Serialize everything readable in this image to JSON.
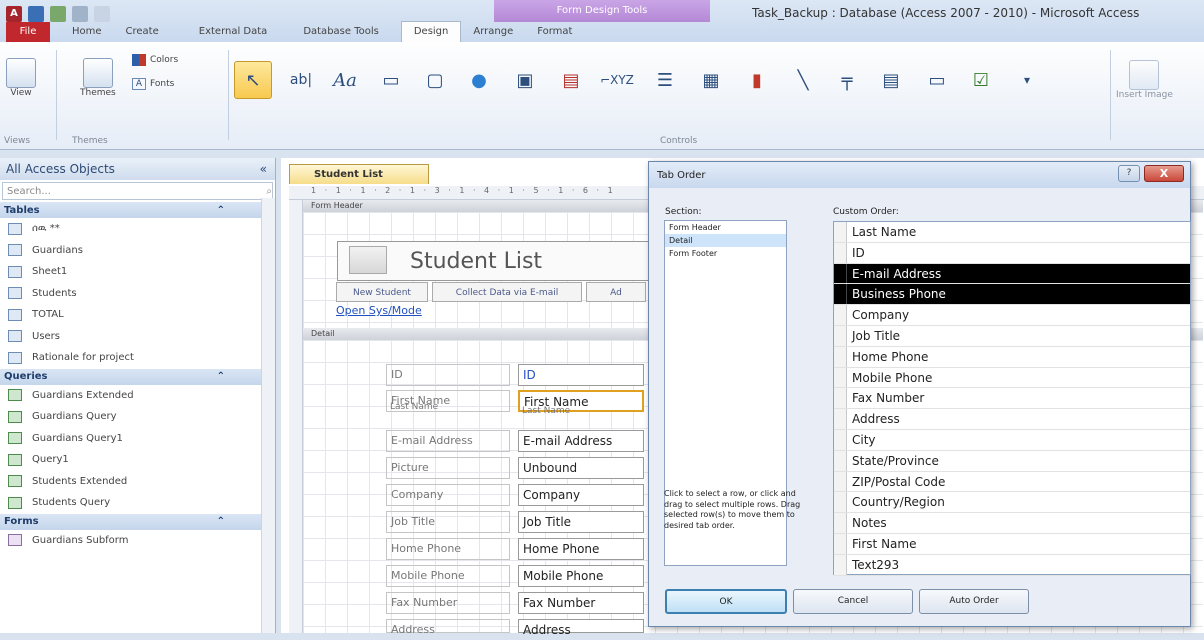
{
  "window": {
    "title": "Task_Backup : Database (Access 2007 - 2010)  -  Microsoft Access"
  },
  "app_icon_label": "A",
  "context_tab": {
    "label": "Form Design Tools"
  },
  "ribbon_tabs": [
    {
      "label": "File"
    },
    {
      "label": "Home"
    },
    {
      "label": "Create"
    },
    {
      "label": "External Data"
    },
    {
      "label": "Database Tools"
    },
    {
      "label": "Design"
    },
    {
      "label": "Arrange"
    },
    {
      "label": "Format"
    }
  ],
  "ribbon": {
    "view_label": "View",
    "themes_label": "Themes",
    "colors_label": "Colors",
    "fonts_label": "Fonts",
    "group_views": "Views",
    "group_themes": "Themes",
    "group_controls": "Controls",
    "insert_image_label": "Insert Image",
    "controls": [
      "pointer-icon",
      "textbox-icon",
      "label-icon",
      "button-icon",
      "tabcontrol-icon",
      "hyperlink-icon",
      "webbrowser-icon",
      "navigation-icon",
      "optiongroup-icon",
      "pagebreak-icon",
      "combobox-icon",
      "chart-icon",
      "line-icon",
      "togglebutton-icon",
      "listbox-icon",
      "rectangle-icon",
      "checkbox-icon"
    ]
  },
  "nav": {
    "header": "All Access Objects",
    "search_placeholder": "Search...",
    "tables_header": "Tables",
    "tables": [
      "ሰዉ **",
      "Guardians",
      "Sheet1",
      "Students",
      "TOTAL",
      "Users",
      "Rationale for project"
    ],
    "queries_header": "Queries",
    "queries": [
      "Guardians Extended",
      "Guardians Query",
      "Guardians Query1",
      "Query1",
      "Students Extended",
      "Students Query"
    ],
    "forms_header": "Forms",
    "forms": [
      "Guardians Subform"
    ]
  },
  "doc": {
    "tab_label": "Student List",
    "ruler_marks": "1 · 1 · 1 · 2 · 1 · 3 · 1 · 4 · 1 · 5 · 1 · 6 · 1",
    "form_header_band": "Form Header",
    "detail_band": "Detail",
    "title": "Student List",
    "header_buttons": [
      "New Student",
      "Collect Data via E-mail",
      "Ad"
    ],
    "hyperlink": "Open Sys/Mode",
    "fields": [
      {
        "label": "ID",
        "box": "ID"
      },
      {
        "label": "First Name",
        "box": "First Name"
      },
      {
        "label": "E-mail Address",
        "box": "E-mail Address"
      },
      {
        "label": "Picture",
        "box": "Unbound"
      },
      {
        "label": "Company",
        "box": "Company"
      },
      {
        "label": "Job Title",
        "box": "Job Title"
      },
      {
        "label": "Home Phone",
        "box": "Home Phone"
      },
      {
        "label": "Mobile Phone",
        "box": "Mobile Phone"
      },
      {
        "label": "Fax Number",
        "box": "Fax Number"
      },
      {
        "label": "Address",
        "box": "Address"
      }
    ],
    "overlap_label": "Last Name",
    "overlap_box": "Last Name"
  },
  "dialog": {
    "title": "Tab Order",
    "help": "?",
    "close": "X",
    "section_label": "Section:",
    "sections": [
      "Form Header",
      "Detail",
      "Form Footer"
    ],
    "selected_section": "Detail",
    "custom_order_label": "Custom Order:",
    "custom_order": [
      "Last Name",
      "ID",
      "E-mail Address",
      "Business Phone",
      "Company",
      "Job Title",
      "Home Phone",
      "Mobile Phone",
      "Fax Number",
      "Address",
      "City",
      "State/Province",
      "ZIP/Postal Code",
      "Country/Region",
      "Notes",
      "First Name",
      "Text293"
    ],
    "selected_rows": [
      "E-mail Address",
      "Business Phone"
    ],
    "hint": "Click to select a row, or click and drag to select multiple rows. Drag selected row(s) to move them to desired tab order.",
    "ok": "OK",
    "cancel": "Cancel",
    "auto_order": "Auto Order"
  }
}
